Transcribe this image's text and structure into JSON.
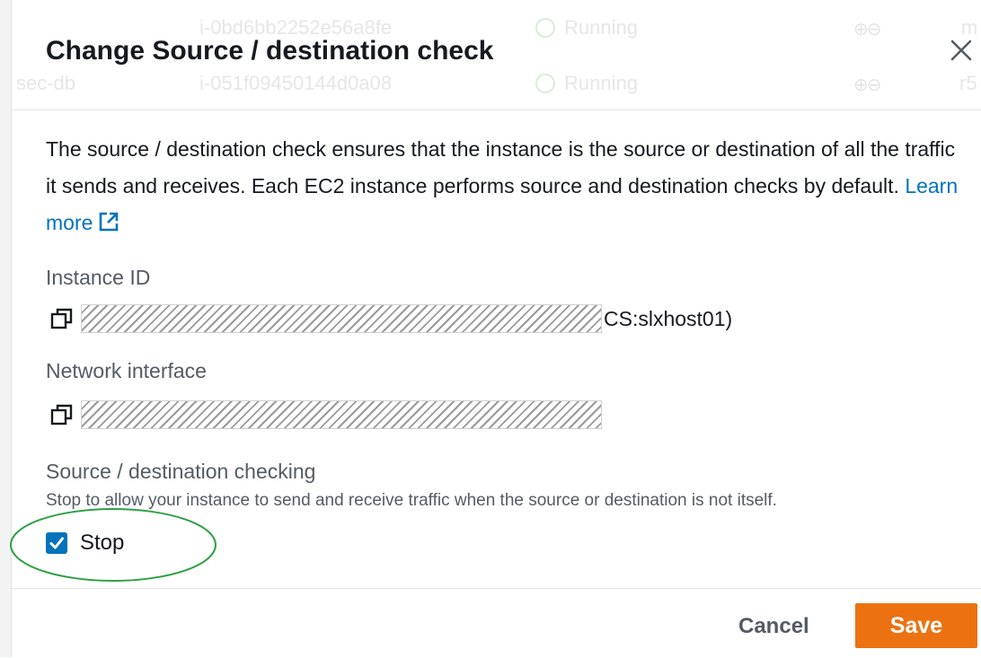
{
  "background_table": {
    "rows": [
      {
        "name": "",
        "instance_id": "i-0bd6bb2252e56a8fe",
        "status": "Running",
        "extra": "m"
      },
      {
        "name": "sec-db",
        "instance_id": "i-051f09450144d0a08",
        "status": "Running",
        "extra": "r5"
      }
    ]
  },
  "modal": {
    "title": "Change Source / destination check",
    "close_icon": "close-icon",
    "description": "The source / destination check ensures that the instance is the source or destination of all the traffic it sends and receives. Each EC2 instance performs source and destination checks by default.",
    "learn_more": "Learn more",
    "instance_id": {
      "label": "Instance ID",
      "value_suffix": "CS:slxhost01)"
    },
    "network_interface": {
      "label": "Network interface"
    },
    "source_dest": {
      "label": "Source / destination checking",
      "description": "Stop to allow your instance to send and receive traffic when the source or destination is not itself.",
      "checkbox_label": "Stop",
      "checked": true
    },
    "footer": {
      "cancel": "Cancel",
      "save": "Save"
    }
  },
  "colors": {
    "accent": "#0073bb",
    "primary_button": "#ec7211",
    "highlight_ellipse": "#2ea043"
  }
}
